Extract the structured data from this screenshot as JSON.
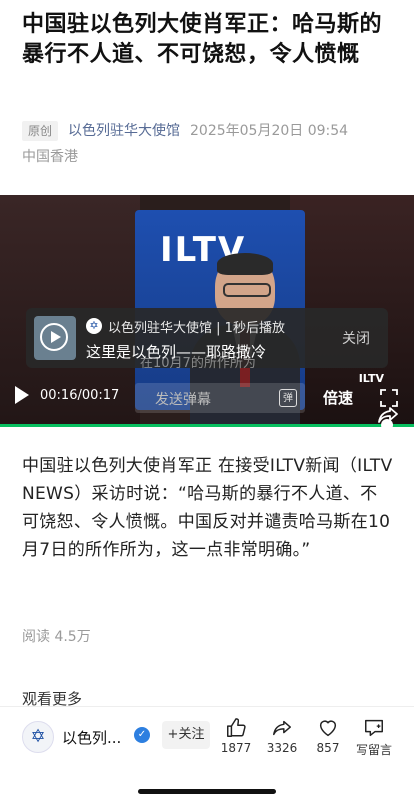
{
  "article": {
    "title": "中国驻以色列大使肖军正：哈马斯的暴行不人道、不可饶恕，令人愤慨",
    "original_badge": "原创",
    "account": "以色列驻华大使馆",
    "datetime": "2025年05月20日 09:54",
    "location": "中国香港",
    "body": "中国驻以色列大使肖军正 在接受ILTV新闻（ILTV NEWS）采访时说：“哈马斯的暴行不人道、不可饶恕、令人愤慨。中国反对并谴责哈马斯在10月7日的所作所为，这一点非常明确。”",
    "reads": "阅读 4.5万",
    "more": "观看更多"
  },
  "video": {
    "logo": "ILTV",
    "caption": "在10月7的所作所为",
    "time": "00:16/00:17",
    "danmu_placeholder": "发送弹幕",
    "danmu_icon": "弹",
    "speed_label": "倍速",
    "progress": 0.94,
    "popup": {
      "name": "以色列驻华大使馆",
      "countdown": "1秒后播放",
      "desc": "这里是以色列——耶路撒冷",
      "close": "关闭"
    },
    "corner_logo": "ILTV"
  },
  "bottom_bar": {
    "account_short": "以色列...",
    "follow": "+关注",
    "likes": "1877",
    "shares": "3326",
    "favorites": "857",
    "comment": "写留言"
  },
  "colors": {
    "accent_green": "#08c060",
    "link_blue": "#576b95"
  }
}
